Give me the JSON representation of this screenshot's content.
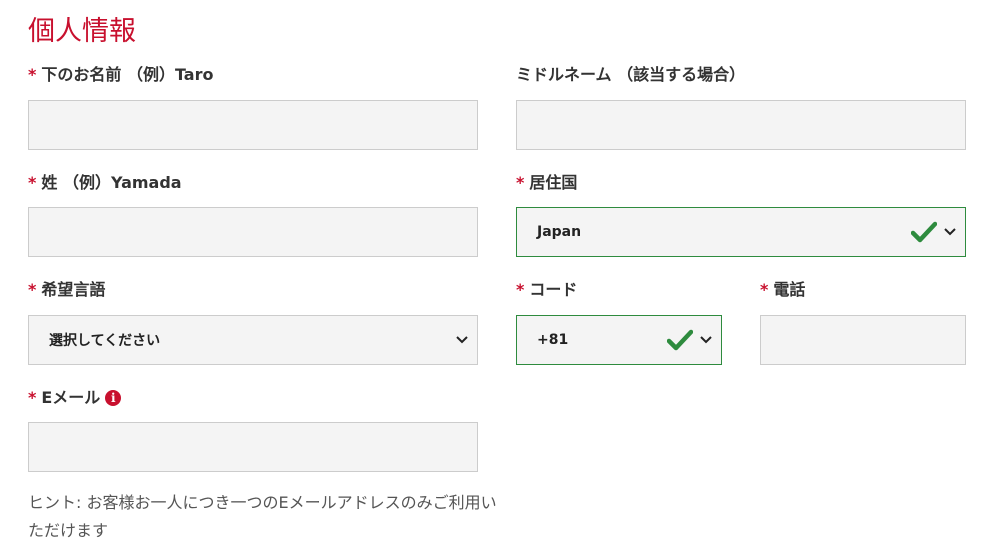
{
  "section": {
    "title": "個人情報"
  },
  "required_mark": "*",
  "first_name": {
    "label": "下のお名前 （例）Taro",
    "value": ""
  },
  "middle_name": {
    "label": "ミドルネーム （該当する場合）",
    "value": ""
  },
  "last_name": {
    "label": "姓 （例）Yamada",
    "value": ""
  },
  "country": {
    "label": "居住国",
    "selected": "Japan",
    "valid": true
  },
  "language": {
    "label": "希望言語",
    "selected": "選択してください"
  },
  "code": {
    "label": "コード",
    "selected": "+81",
    "valid": true
  },
  "phone": {
    "label": "電話",
    "value": ""
  },
  "email": {
    "label": "Eメール",
    "value": "",
    "info_icon": "info-icon"
  },
  "hint": "ヒント: お客様お一人につき一つのEメールアドレスのみご利用いただけます",
  "colors": {
    "accent": "#c8102e",
    "valid": "#2e8b3e",
    "field_bg": "#f4f4f4"
  }
}
